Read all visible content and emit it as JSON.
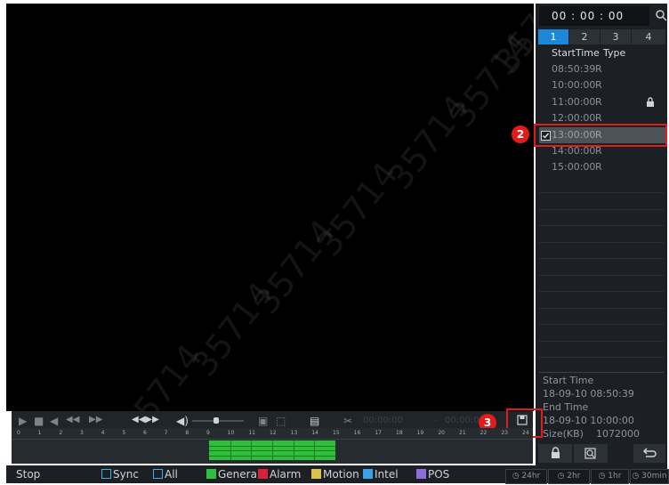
{
  "search": {
    "time_value": "00 : 00 : 00",
    "icon": "search-icon"
  },
  "channel_tabs": [
    "1",
    "2",
    "3",
    "4"
  ],
  "list_header": {
    "start_time": "StartTime",
    "type": "Type"
  },
  "records": [
    {
      "time": "08:50:39",
      "type": "R",
      "locked": false,
      "selected": false
    },
    {
      "time": "10:00:00",
      "type": "R",
      "locked": false,
      "selected": false
    },
    {
      "time": "11:00:00",
      "type": "R",
      "locked": true,
      "selected": false
    },
    {
      "time": "12:00:00",
      "type": "R",
      "locked": false,
      "selected": false
    },
    {
      "time": "13:00:00",
      "type": "R",
      "locked": false,
      "selected": true
    },
    {
      "time": "14:00:00",
      "type": "R",
      "locked": false,
      "selected": false
    },
    {
      "time": "15:00:00",
      "type": "R",
      "locked": false,
      "selected": false
    }
  ],
  "info": {
    "start_label": "Start Time",
    "start_value": "18-09-10 08:50:39",
    "end_label": "End Time",
    "end_value": "18-09-10 10:00:00",
    "size_label": "Size(KB)",
    "size_value": "1072000"
  },
  "playback": {
    "time_display": "00:00:00",
    "time_display_2": "00:00:00"
  },
  "timeline": {
    "ticks": [
      "0",
      "1",
      "2",
      "3",
      "4",
      "5",
      "6",
      "7",
      "8",
      "9",
      "10",
      "11",
      "12",
      "13",
      "14",
      "15",
      "16",
      "17",
      "18",
      "19",
      "20",
      "21",
      "22",
      "23",
      "24"
    ],
    "recorded_range": [
      9,
      15
    ]
  },
  "status": {
    "state": "Stop",
    "sync": "Sync",
    "all": "All",
    "general": "General",
    "alarm": "Alarm",
    "motion": "Motion",
    "intel": "Intel",
    "pos": "POS",
    "zoom": [
      "24hr",
      "2hr",
      "1hr",
      "30min"
    ]
  },
  "colors": {
    "general": "#2fbf3a",
    "alarm": "#d8213a",
    "motion": "#d8c34a",
    "intel": "#3aa0e8",
    "pos": "#8a6fd8",
    "accent": "#1e88d8",
    "highlight": "#e21b1b"
  },
  "annotations": {
    "badge_2": "2",
    "badge_3": "3"
  },
  "watermark": "35714"
}
